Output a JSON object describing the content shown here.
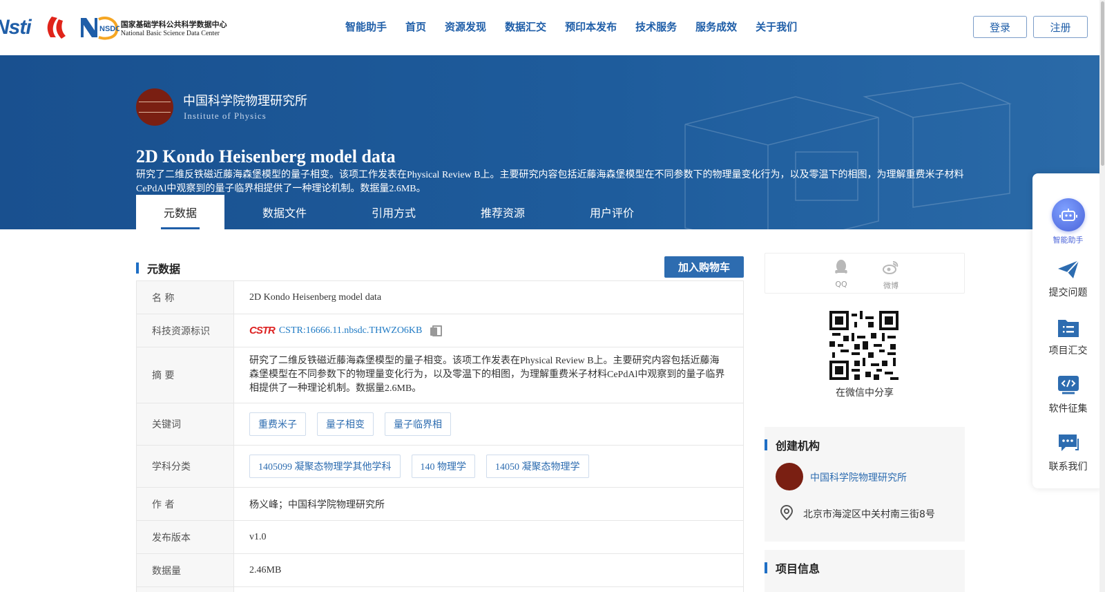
{
  "header": {
    "logo_cstr": "Nsti",
    "logo_nsdc_cn": "国家基础学科公共科学数据中心",
    "logo_nsdc_en": "National Basic Science Data Center",
    "logo_nsdc_mark": "NSDC",
    "menu": [
      "智能助手",
      "首页",
      "资源发现",
      "数据汇交",
      "预印本发布",
      "技术服务",
      "服务成效",
      "关于我们"
    ],
    "login": "登录",
    "register": "注册"
  },
  "hero": {
    "org_name": "中国科学院物理研究所",
    "org_en": "Institute of Physics",
    "title": "2D Kondo Heisenberg model data",
    "description": "研究了二维反铁磁近藤海森堡模型的量子相变。该项工作发表在Physical Review B上。主要研究内容包括近藤海森堡模型在不同参数下的物理量变化行为，以及零温下的相图，为理解重费米子材料CePdAl中观察到的量子临界相提供了一种理论机制。数据量2.6MB。",
    "tabs": [
      "元数据",
      "数据文件",
      "引用方式",
      "推荐资源",
      "用户评价"
    ],
    "active_tab": 0
  },
  "metadata": {
    "section_title": "元数据",
    "cart_button": "加入购物车",
    "labels": {
      "name": "名    称",
      "cstr": "科技资源标识",
      "abstract": "摘    要",
      "keywords": "关键词",
      "subject": "学科分类",
      "author": "作    者",
      "version": "发布版本",
      "size": "数据量"
    },
    "name": "2D Kondo Heisenberg model data",
    "cstr_badge": "CSTR",
    "cstr": "CSTR:16666.11.nbsdc.THWZO6KB",
    "abstract": "研究了二维反铁磁近藤海森堡模型的量子相变。该项工作发表在Physical Review B上。主要研究内容包括近藤海森堡模型在不同参数下的物理量变化行为，以及零温下的相图，为理解重费米子材料CePdAl中观察到的量子临界相提供了一种理论机制。数据量2.6MB。",
    "keywords": [
      "重费米子",
      "量子相变",
      "量子临界相"
    ],
    "subjects": [
      "1405099 凝聚态物理学其他学科",
      "140 物理学",
      "14050 凝聚态物理学"
    ],
    "author": "杨义峰；中国科学院物理研究所",
    "version": "v1.0",
    "size": "2.46MB"
  },
  "share": {
    "qq": "QQ",
    "weibo": "微博",
    "wechat_caption": "在微信中分享"
  },
  "creator": {
    "title": "创建机构",
    "org_name": "中国科学院物理研究所",
    "address": "北京市海淀区中关村南三街8号"
  },
  "project": {
    "title": "项目信息"
  },
  "side_toolbar": {
    "assistant": "智能助手",
    "items": [
      "提交问题",
      "项目汇交",
      "软件征集",
      "联系我们"
    ]
  },
  "colors": {
    "primary": "#1f5ea8",
    "hero_bg": "#19508f",
    "cart_button": "#2d6cb0",
    "assistant": "#4a63d9"
  }
}
